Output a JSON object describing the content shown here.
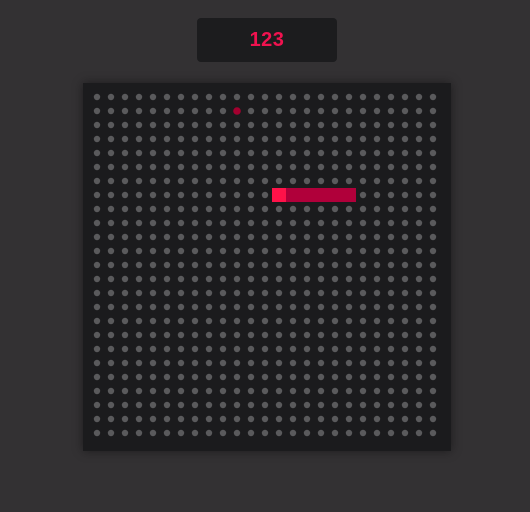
{
  "score": {
    "value": "123"
  },
  "board": {
    "columns": 25,
    "rows": 25
  },
  "snake": {
    "head": [
      13,
      7
    ],
    "body": [
      [
        14,
        7
      ],
      [
        15,
        7
      ],
      [
        16,
        7
      ],
      [
        17,
        7
      ],
      [
        18,
        7
      ]
    ]
  },
  "food": {
    "cell": [
      10,
      1
    ]
  },
  "colors": {
    "background": "#333133",
    "board": "#1b1b1d",
    "dot": "#5a5a5c",
    "score_text": "#f0124f",
    "snake_head": "#ff1249",
    "snake_body": "#b0003a",
    "food": "#a3002f"
  },
  "icons": {
    "food": "food-dot-icon"
  }
}
